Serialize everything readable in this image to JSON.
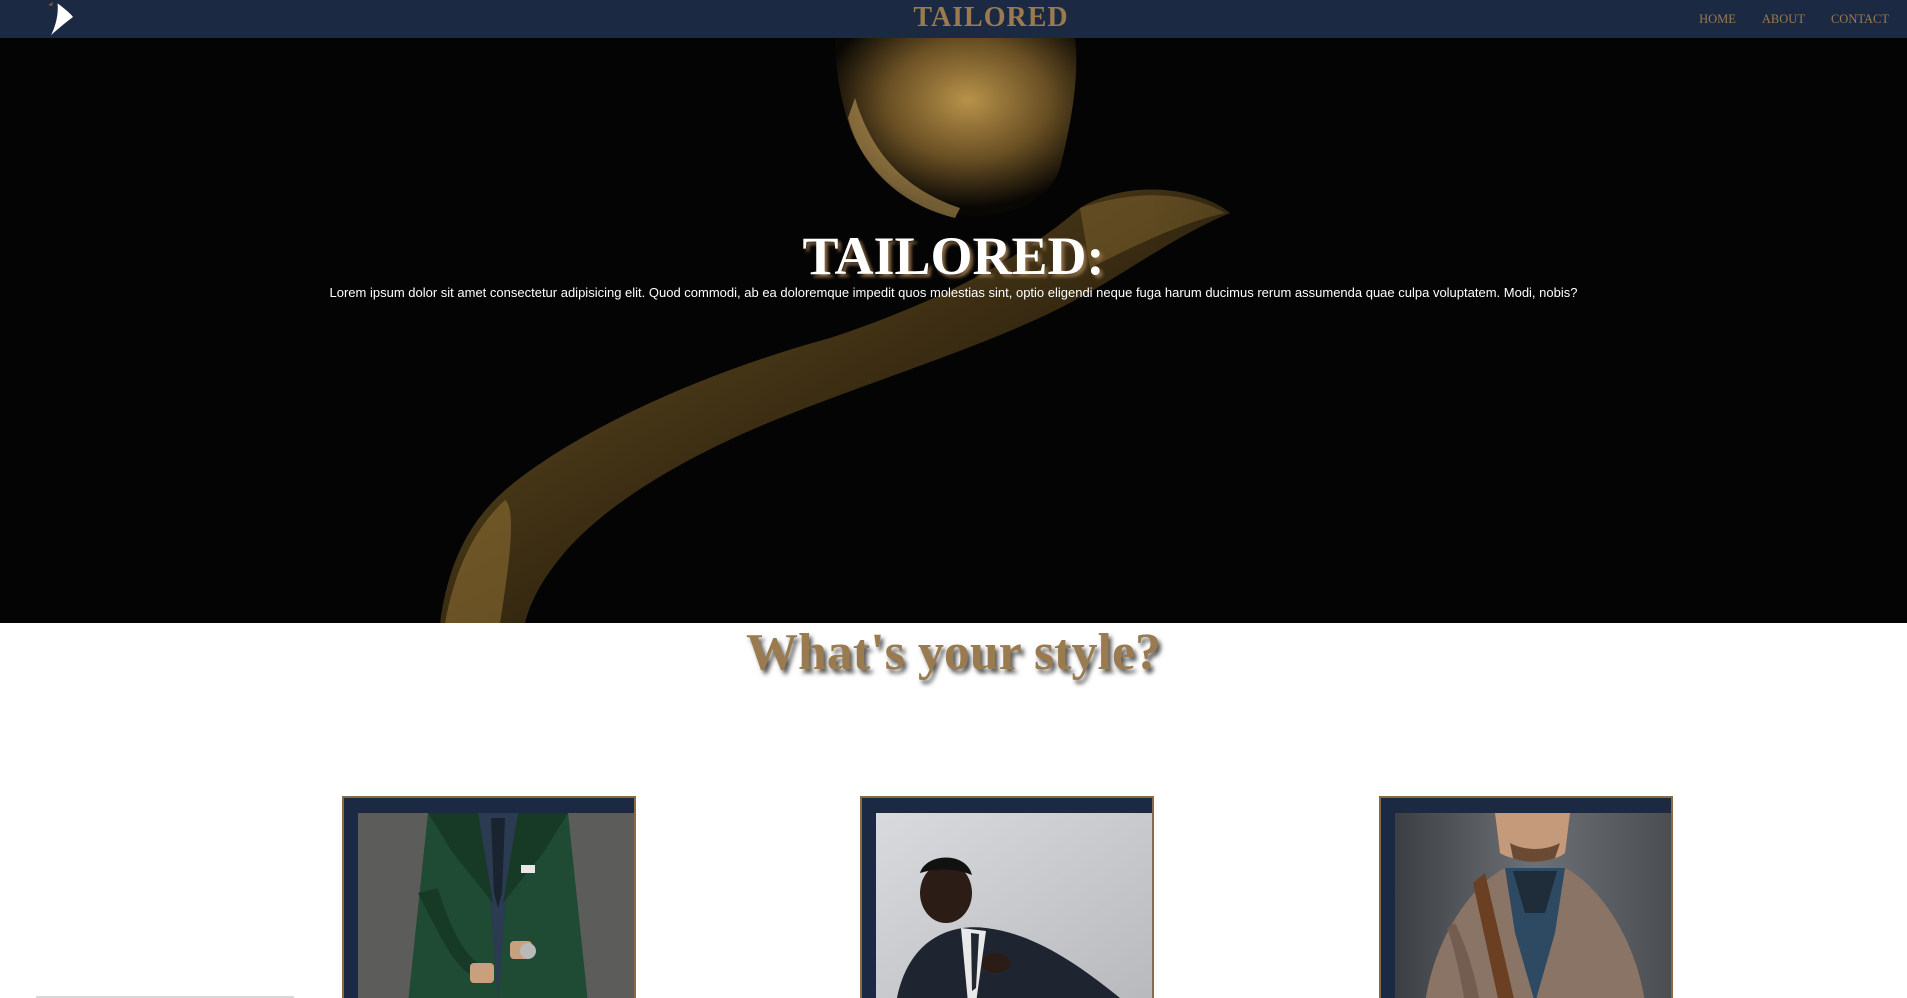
{
  "nav": {
    "brand": "TAILORED",
    "logo_icon": "feather-logo-icon",
    "links": [
      {
        "label": "HOME"
      },
      {
        "label": "ABOUT"
      },
      {
        "label": "CONTACT"
      }
    ]
  },
  "hero": {
    "title": "TAILORED:",
    "text": "Lorem ipsum dolor sit amet consectetur adipisicing elit. Quod commodi, ab ea doloremque impedit quos molestias sint, optio eligendi neque fuga harum ducimus rerum assumenda quae culpa voluptatem. Modi, nobis?"
  },
  "styles": {
    "title": "What's your style?",
    "cards": [
      {
        "image": "man in green suit photo"
      },
      {
        "image": "man in dark suit adjusting tie photo"
      },
      {
        "image": "man in brown tweed jacket photo"
      }
    ]
  },
  "colors": {
    "navy": "#1b2942",
    "gold": "#9a7a4f",
    "hero_bg": "#040404"
  }
}
